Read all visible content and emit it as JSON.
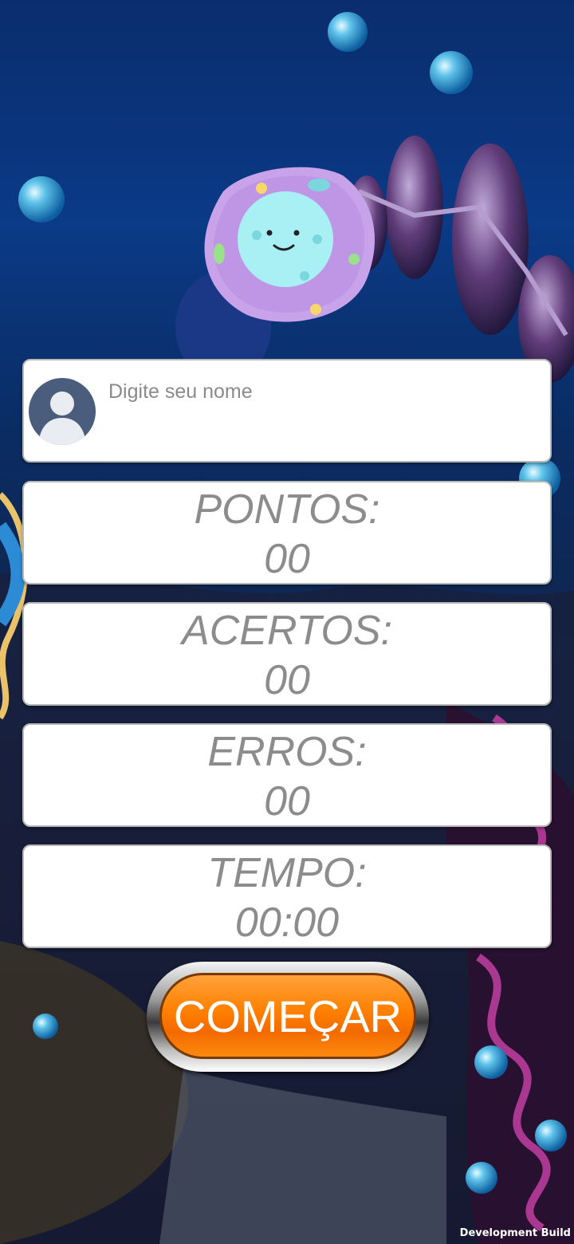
{
  "player": {
    "name_placeholder": "Digite seu nome",
    "avatar_icon": "user-avatar-icon"
  },
  "stats": {
    "points": {
      "label": "PONTOS:",
      "value": "00"
    },
    "hits": {
      "label": "ACERTOS:",
      "value": "00"
    },
    "errors": {
      "label": "ERROS:",
      "value": "00"
    },
    "time": {
      "label": "TEMPO:",
      "value": "00:00"
    }
  },
  "start_label": "COMEÇAR",
  "footer": {
    "build_label": "Development Build"
  },
  "colors": {
    "button_orange": "#ff7f00",
    "stat_text": "#8c8c8c",
    "avatar_bg": "#4a5d7d",
    "mascot_purple": "#c9a3ea",
    "mascot_face": "#a8f0f4"
  }
}
